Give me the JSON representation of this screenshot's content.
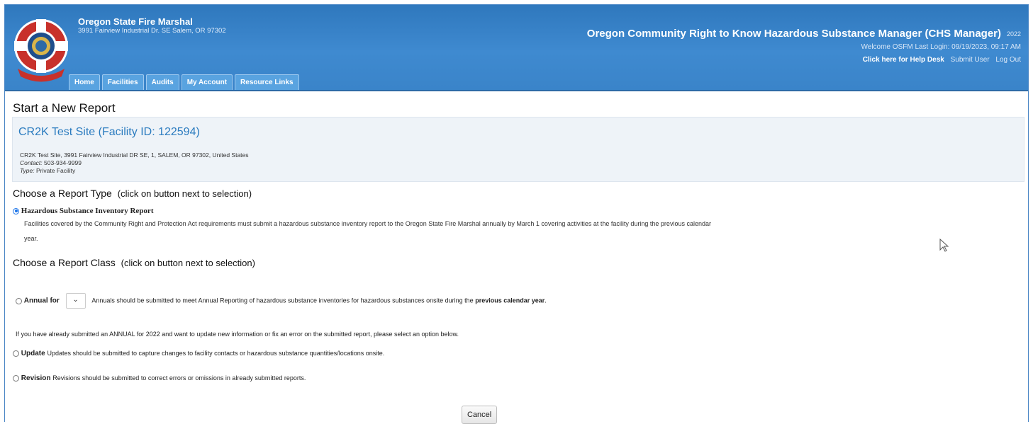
{
  "header": {
    "org_name": "Oregon State Fire Marshal",
    "org_address": "3991 Fairview Industrial Dr. SE Salem, OR 97302",
    "app_title": "Oregon Community Right to Know Hazardous Substance Manager (CHS Manager)",
    "app_year": "2022",
    "welcome": "Welcome OSFM  Last Login: 09/19/2023, 09:17 AM",
    "help_link": "Click here for Help Desk",
    "submit_user": "Submit User",
    "logout": "Log Out",
    "logo_text_top": "OREGON STATE FIRE MARSHAL",
    "logo_text_bottom": "SERVING SINCE 1917"
  },
  "nav": {
    "tabs": [
      "Home",
      "Facilities",
      "Audits",
      "My Account",
      "Resource Links"
    ]
  },
  "page": {
    "title": "Start a New Report"
  },
  "facility": {
    "name": "CR2K Test Site (Facility ID: 122594)",
    "address": "CR2K Test Site, 3991 Fairview Industrial DR SE, 1, SALEM, OR 97302, United States",
    "contact_label": "Contact:",
    "contact_value": "503-934-9999",
    "type_label": "Type:",
    "type_value": "Private Facility"
  },
  "report_type": {
    "heading": "Choose a Report Type",
    "hint": "(click on button next to selection)",
    "option_label": "Hazardous Substance Inventory Report",
    "option_selected": true,
    "description_line1": "Facilities covered by the Community Right and Protection Act requirements must submit a hazardous substance inventory report to the Oregon State Fire Marshal annually by March 1 covering activities at the facility during the previous calendar",
    "description_line2": "year."
  },
  "report_class": {
    "heading": "Choose a Report Class",
    "hint": "(click on button next to selection)",
    "annual_label": "Annual for",
    "annual_select_value": "",
    "annual_desc_prefix": "Annuals should be submitted to meet Annual Reporting of hazardous substance inventories for hazardous substances onsite during the",
    "annual_desc_bold": "previous calendar year",
    "annual_desc_suffix": ".",
    "already_submitted_note": "If you have already submitted an ANNUAL for 2022 and want to update new information or fix an error on the submitted report, please select an option below.",
    "update_label": "Update",
    "update_desc": "Updates should be submitted to capture changes to facility contacts or hazardous substance quantities/locations onsite.",
    "revision_label": "Revision",
    "revision_desc": "Revisions should be submitted to correct errors or omissions in already submitted reports."
  },
  "actions": {
    "cancel_label": "Cancel"
  },
  "icons": {
    "logo": "osfm-seal-icon",
    "select_arrow": "chevron-down-icon",
    "cursor": "mouse-pointer-icon"
  },
  "colors": {
    "header_blue": "#3a84c9",
    "tab_blue": "#59a3e0",
    "facility_link": "#2a7bbf",
    "logo_red": "#c8312b"
  }
}
